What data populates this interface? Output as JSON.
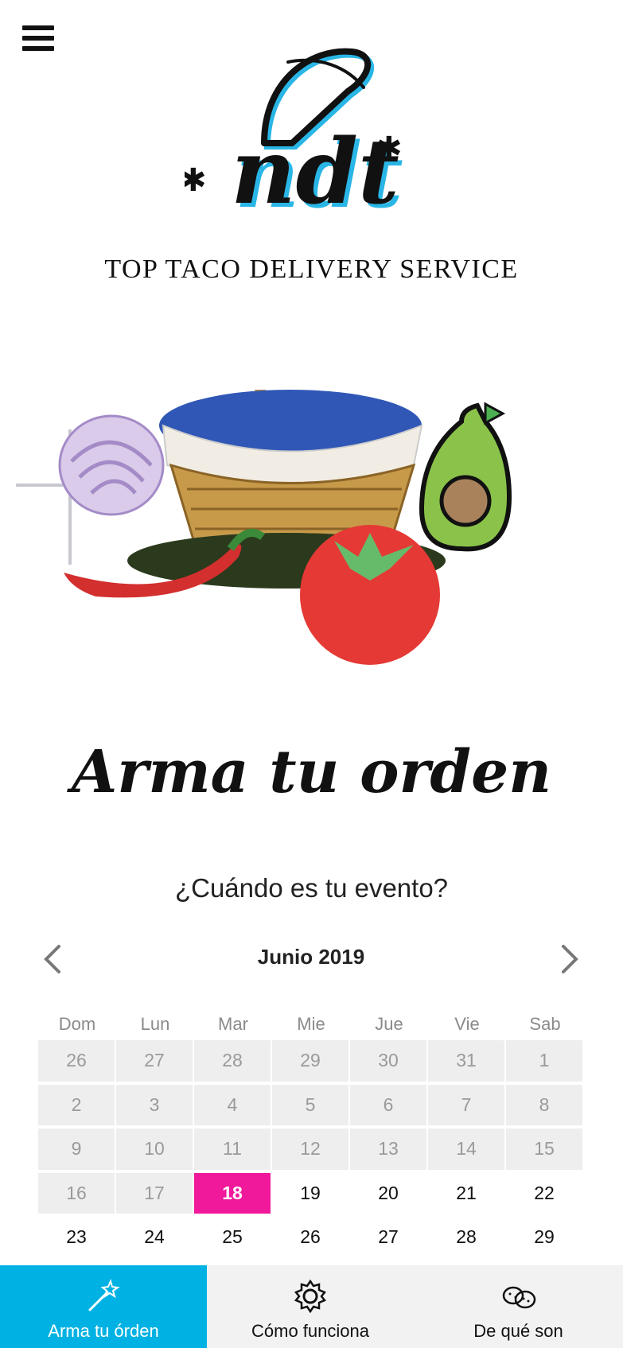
{
  "header": {
    "menu_icon": "hamburger-menu-icon",
    "logo_text": "ndt",
    "tagline": "TOP TACO DELIVERY SERVICE"
  },
  "hero": {
    "illustration": "basket-with-vegetables"
  },
  "main": {
    "headline": "Arma tu orden",
    "question": "¿Cuándo es tu evento?"
  },
  "calendar": {
    "month_label": "Junio 2019",
    "prev_icon": "chevron-left-icon",
    "next_icon": "chevron-right-icon",
    "weekdays": [
      "Dom",
      "Lun",
      "Mar",
      "Mie",
      "Jue",
      "Vie",
      "Sab"
    ],
    "days": [
      {
        "label": "26",
        "state": "disabled"
      },
      {
        "label": "27",
        "state": "disabled"
      },
      {
        "label": "28",
        "state": "disabled"
      },
      {
        "label": "29",
        "state": "disabled"
      },
      {
        "label": "30",
        "state": "disabled"
      },
      {
        "label": "31",
        "state": "disabled"
      },
      {
        "label": "1",
        "state": "disabled"
      },
      {
        "label": "2",
        "state": "disabled"
      },
      {
        "label": "3",
        "state": "disabled"
      },
      {
        "label": "4",
        "state": "disabled"
      },
      {
        "label": "5",
        "state": "disabled"
      },
      {
        "label": "6",
        "state": "disabled"
      },
      {
        "label": "7",
        "state": "disabled"
      },
      {
        "label": "8",
        "state": "disabled"
      },
      {
        "label": "9",
        "state": "disabled"
      },
      {
        "label": "10",
        "state": "disabled"
      },
      {
        "label": "11",
        "state": "disabled"
      },
      {
        "label": "12",
        "state": "disabled"
      },
      {
        "label": "13",
        "state": "disabled"
      },
      {
        "label": "14",
        "state": "disabled"
      },
      {
        "label": "15",
        "state": "disabled"
      },
      {
        "label": "16",
        "state": "disabled"
      },
      {
        "label": "17",
        "state": "disabled"
      },
      {
        "label": "18",
        "state": "selected"
      },
      {
        "label": "19",
        "state": "active"
      },
      {
        "label": "20",
        "state": "active"
      },
      {
        "label": "21",
        "state": "active"
      },
      {
        "label": "22",
        "state": "active"
      },
      {
        "label": "23",
        "state": "active"
      },
      {
        "label": "24",
        "state": "active"
      },
      {
        "label": "25",
        "state": "active"
      },
      {
        "label": "26",
        "state": "active"
      },
      {
        "label": "27",
        "state": "active"
      },
      {
        "label": "28",
        "state": "active"
      },
      {
        "label": "29",
        "state": "active"
      }
    ],
    "selected_color": "#f0189b",
    "disabled_bg": "#eeeeee"
  },
  "bottom_nav": {
    "items": [
      {
        "label": "Arma tu órden",
        "icon": "magic-wand-icon",
        "active": true
      },
      {
        "label": "Cómo funciona",
        "icon": "gear-icon",
        "active": false
      },
      {
        "label": "De qué son",
        "icon": "potatoes-icon",
        "active": false
      }
    ],
    "active_color": "#00b2e3"
  },
  "colors": {
    "brand_blue": "#00b2e3",
    "accent_pink": "#f0189b"
  }
}
